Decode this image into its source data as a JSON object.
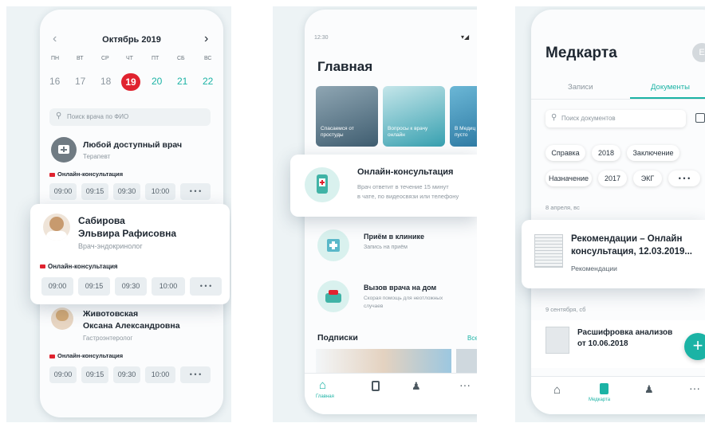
{
  "screen1": {
    "calendar": {
      "prev": "‹",
      "next": "›",
      "month": "Октябрь 2019",
      "weekdays": [
        "ПН",
        "ВТ",
        "СР",
        "ЧТ",
        "ПТ",
        "СБ",
        "ВС"
      ],
      "days": [
        "16",
        "17",
        "18",
        "19",
        "20",
        "21",
        "22"
      ],
      "selected_day": "19"
    },
    "search_placeholder": "Поиск врача по ФИО",
    "doctor1": {
      "name": "Любой доступный врач",
      "specialty": "Терапевт",
      "consult": "Онлайн-консультация",
      "slots": [
        "09:00",
        "09:15",
        "09:30",
        "10:00",
        "• • •"
      ]
    },
    "doctor2": {
      "name_line1": "Сабирова",
      "name_line2": "Эльвира Рафисовна",
      "specialty": "Врач-эндокринолог",
      "consult": "Онлайн-консультация",
      "slots": [
        "09:00",
        "09:15",
        "09:30",
        "10:00",
        "• • •"
      ]
    },
    "doctor3": {
      "name_line1": "Животовская",
      "name_line2": "Оксана Александровна",
      "specialty": "Гастроэнтеролог",
      "consult": "Онлайн-консультация",
      "slots": [
        "09:00",
        "09:15",
        "09:30",
        "10:00",
        "• • •"
      ]
    }
  },
  "screen2": {
    "status_time": "12:30",
    "title": "Главная",
    "stories": [
      {
        "label": "Спасаемся от простуды",
        "color": "#4a6b80"
      },
      {
        "label": "Вопросы к врачу онлайн",
        "color": "#3aa3b3"
      },
      {
        "label": "В Медиц пусто",
        "color": "#2e7fa6"
      }
    ],
    "online": {
      "title": "Онлайн-консультация",
      "desc_line1": "Врач ответит в течение 15 минут",
      "desc_line2": "в чате, по видеосвязи или телефону"
    },
    "clinic": {
      "title": "Приём в клинике",
      "desc": "Запись на приём"
    },
    "home": {
      "title": "Вызов врача на дом",
      "desc_line1": "Скорая помощь для неотложных",
      "desc_line2": "случаев"
    },
    "subscriptions": {
      "title": "Подписки",
      "link": "Все"
    },
    "tabbar": {
      "home_label": "Главная"
    }
  },
  "screen3": {
    "title": "Медкарта",
    "avatar_letter": "Е",
    "tabs": [
      "Записи",
      "Документы"
    ],
    "search_placeholder": "Поиск документов",
    "filters_row1": [
      "Справка",
      "2018",
      "Заключение"
    ],
    "filters_row2": [
      "Назначение",
      "2017",
      "ЭКГ",
      "• • •"
    ],
    "date1": "8 апреля, вс",
    "doc1": {
      "title_line1": "Рекомендации – Онлайн",
      "title_line2": "консультация, 12.03.2019...",
      "type": "Рекомендации"
    },
    "date2": "9 сентября, сб",
    "doc2": {
      "title_line1": "Расшифровка анализов",
      "title_line2": "от 10.06.2018"
    },
    "fab": "+",
    "tabbar": {
      "medcard_label": "Медкарта"
    }
  },
  "colors": {
    "accent": "#1bb3a5",
    "alert": "#e0232f",
    "panel_bg": "#edf3f5"
  }
}
